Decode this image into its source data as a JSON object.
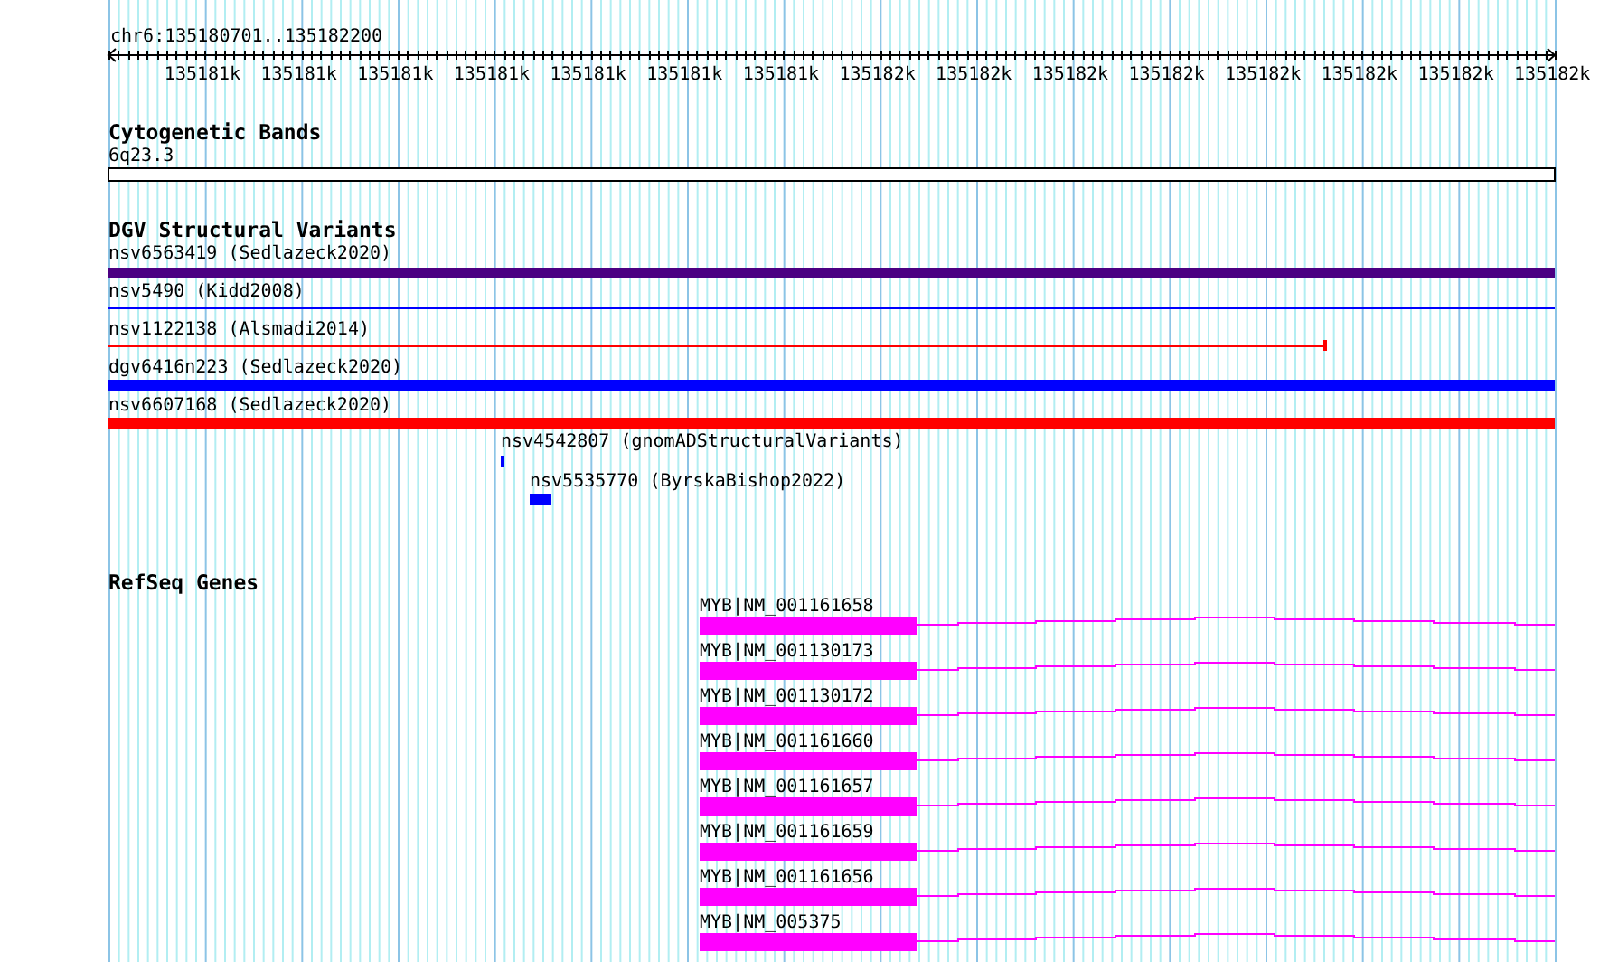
{
  "location": "chr6:135180701..135182200",
  "ruler": {
    "tick_labels": [
      "135181k",
      "135181k",
      "135181k",
      "135181k",
      "135181k",
      "135181k",
      "135181k",
      "135182k",
      "135182k",
      "135182k",
      "135182k",
      "135182k",
      "135182k",
      "135182k",
      "135182k"
    ]
  },
  "tracks": [
    {
      "kind": "cytoband",
      "title": "Cytogenetic Bands",
      "features": [
        {
          "label": "6q23.3"
        }
      ]
    },
    {
      "kind": "variants",
      "title": "DGV Structural Variants",
      "features": [
        {
          "label": "nsv6563419 (Sedlazeck2020)",
          "kind": "bar",
          "color": "#4b0082"
        },
        {
          "label": "nsv5490 (Kidd2008)",
          "kind": "line",
          "color": "#0000ff"
        },
        {
          "label": "nsv1122138 (Alsmadi2014)",
          "kind": "line",
          "color": "#ff0000"
        },
        {
          "label": "dgv6416n223 (Sedlazeck2020)",
          "kind": "bar",
          "color": "#0000ff"
        },
        {
          "label": "nsv6607168 (Sedlazeck2020)",
          "kind": "bar",
          "color": "#ff0000"
        },
        {
          "label": "nsv4542807 (gnomADStructuralVariants)",
          "kind": "bar",
          "color": "#0000ff"
        },
        {
          "label": "nsv5535770 (ByrskaBishop2022)",
          "kind": "bar",
          "color": "#0000ff"
        }
      ]
    },
    {
      "kind": "genes",
      "title": "RefSeq Genes",
      "features": [
        {
          "label": "MYB|NM_001161658",
          "color": "#ff00ff"
        },
        {
          "label": "MYB|NM_001130173",
          "color": "#ff00ff"
        },
        {
          "label": "MYB|NM_001130172",
          "color": "#ff00ff"
        },
        {
          "label": "MYB|NM_001161660",
          "color": "#ff00ff"
        },
        {
          "label": "MYB|NM_001161657",
          "color": "#ff00ff"
        },
        {
          "label": "MYB|NM_001161659",
          "color": "#ff00ff"
        },
        {
          "label": "MYB|NM_001161656",
          "color": "#ff00ff"
        },
        {
          "label": "MYB|NM_005375",
          "color": "#ff00ff"
        }
      ]
    }
  ]
}
